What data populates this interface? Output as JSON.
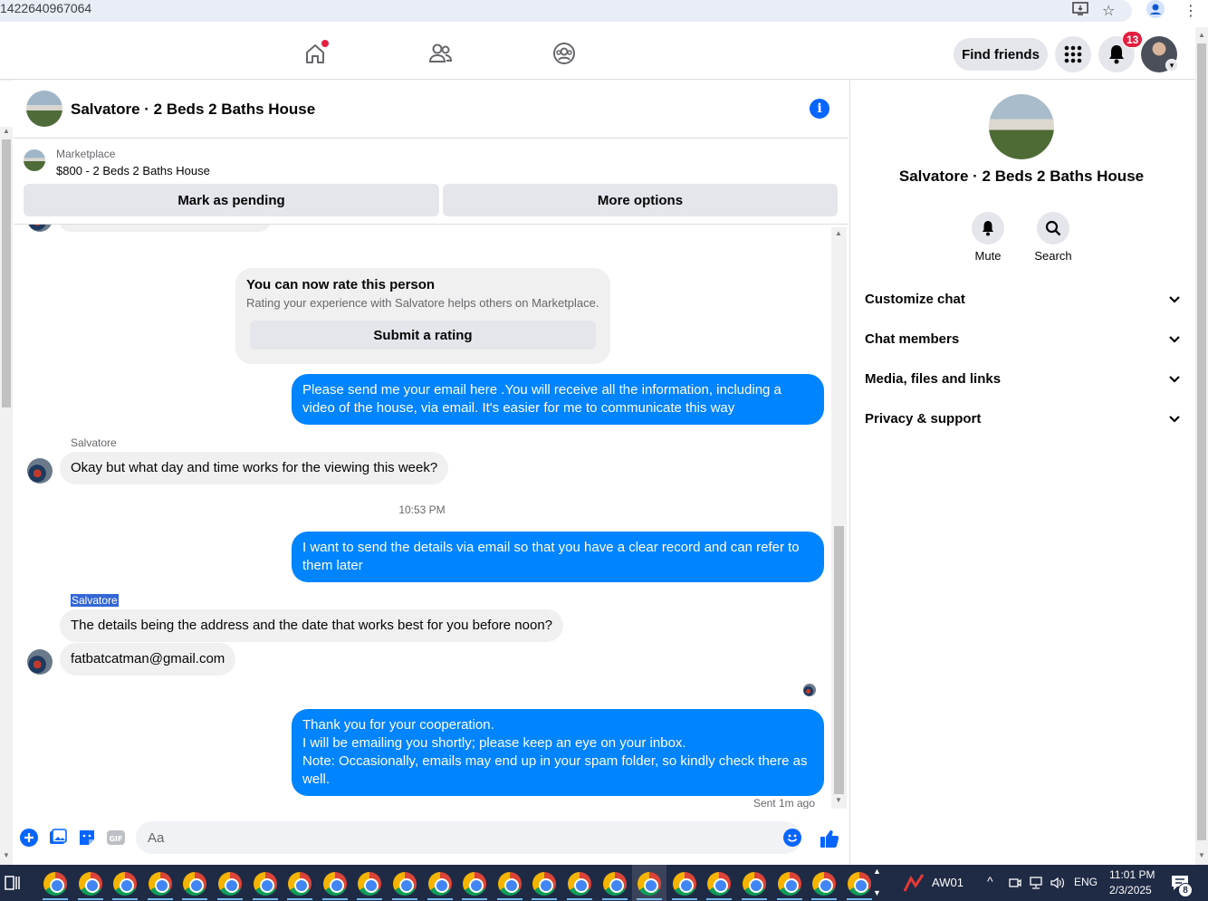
{
  "browser": {
    "url_fragment": "1422640967064"
  },
  "fbnav": {
    "find_friends": "Find friends",
    "notifications_count": "13"
  },
  "thread": {
    "title": "Salvatore · 2 Beds 2 Baths House"
  },
  "marketplace": {
    "label": "Marketplace",
    "description": "$800 - 2 Beds 2 Baths House",
    "mark_pending": "Mark as pending",
    "more_options": "More options"
  },
  "rating": {
    "title": "You can now rate this person",
    "description": "Rating your experience with Salvatore helps others on Marketplace.",
    "button": "Submit a rating"
  },
  "messages": {
    "out1": "Please send me your email here .You will receive all the information, including a video of the house, via email. It's easier for me to communicate this way",
    "sender1": "Salvatore",
    "in1": "Okay but what day and time works for the viewing this week?",
    "timestamp": "10:53 PM",
    "out2": "I want to send the details via email so that you have a clear record and can refer to them later",
    "sender2": "Salvatore",
    "in2": "The details being the address and the date that works best for you before noon?",
    "in3": "fatbatcatman@gmail.com",
    "out3_line1": "Thank you for your cooperation.",
    "out3_line2": "I will be emailing you shortly; please keep an eye on your inbox.",
    "out3_line3": "Note: Occasionally, emails may end up in your spam folder, so kindly check there as well.",
    "sent_status": "Sent 1m ago"
  },
  "composer": {
    "placeholder": "Aa"
  },
  "right_panel": {
    "title": "Salvatore · 2 Beds 2 Baths House",
    "mute": "Mute",
    "search": "Search",
    "sections": [
      "Customize chat",
      "Chat members",
      "Media, files and links",
      "Privacy & support"
    ]
  },
  "taskbar": {
    "app_label": "AW01",
    "language": "ENG",
    "time": "11:01 PM",
    "date": "2/3/2025",
    "notification_count": "8"
  },
  "colors": {
    "messenger_blue": "#0084ff",
    "fb_blue": "#0866ff",
    "badge_red": "#e41e3f"
  }
}
